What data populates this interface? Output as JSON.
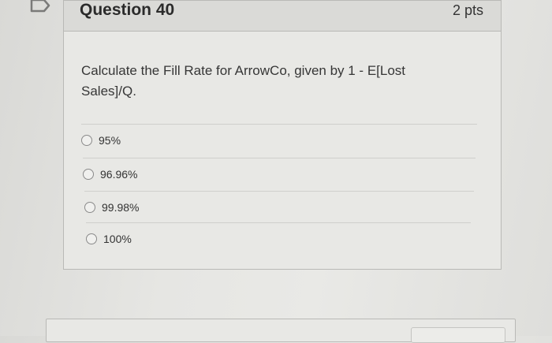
{
  "question": {
    "title": "Question 40",
    "points": "2 pts",
    "text": "Calculate the Fill Rate for ArrowCo, given by 1 - E[Lost Sales]/Q.",
    "flagged": false
  },
  "answers": [
    {
      "label": "95%",
      "selected": false
    },
    {
      "label": "96.96%",
      "selected": false
    },
    {
      "label": "99.98%",
      "selected": false
    },
    {
      "label": "100%",
      "selected": false
    }
  ]
}
